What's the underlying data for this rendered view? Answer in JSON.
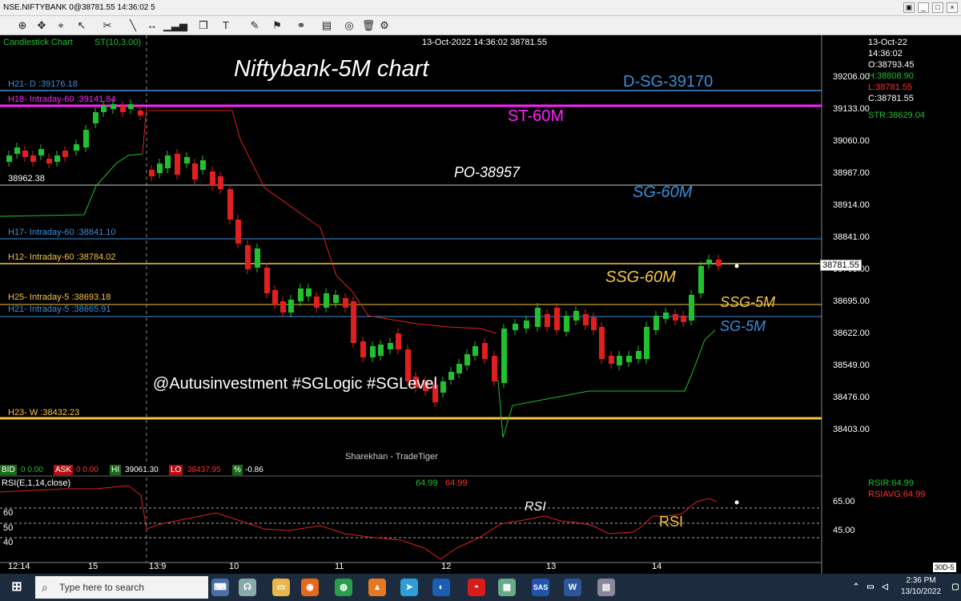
{
  "window": {
    "title": "NSE.NIFTYBANK 0@38781.55 14:36:02 5"
  },
  "toolbar_icons": [
    "crosshair-icon",
    "move-icon",
    "zoom-icon",
    "pointer-icon",
    "line-icon",
    "hline-icon",
    "bars-icon",
    "cube-icon",
    "text-icon",
    "pen-icon",
    "tag-icon",
    "hand-icon",
    "link-icon",
    "book-icon",
    "compass-icon",
    "delete-icon",
    "gear-icon"
  ],
  "chart": {
    "chart_name": "Candlestick Chart",
    "indicator": "ST(10,3.00)",
    "timestamp": "13-Oct-2022 14:36:02 38781.55",
    "big_title": "Niftybank-5M chart",
    "watermark": "@Autusinvestment  #SGLogic  #SGLevel",
    "brand": "Sharekhan - TradeTiger",
    "level_low_label": "38962.38",
    "price_tag": "38781.55"
  },
  "levels": [
    {
      "label": "H21- D :39176.18",
      "color": "#3a8fd8"
    },
    {
      "label": "H18- Intraday-60 :39141.84",
      "color": "#ff22ff"
    },
    {
      "label": "H17- Intraday-60 :38841.10",
      "color": "#3a8fd8"
    },
    {
      "label": "H12- Intraday-60 :38784.02",
      "color": "#f5c542"
    },
    {
      "label": "H25- Intraday-5 :38693.18",
      "color": "#f5c542"
    },
    {
      "label": "H21- Intraday-5 :38665.91",
      "color": "#3a8fd8"
    },
    {
      "label": "H23- W :38432.23",
      "color": "#f5c542"
    }
  ],
  "annotations": [
    {
      "text": "D-SG-39170",
      "color": "#3a8fd8"
    },
    {
      "text": "ST-60M",
      "color": "#ff22ff"
    },
    {
      "text": "PO-38957",
      "color": "#ffffff"
    },
    {
      "text": "SG-60M",
      "color": "#3a8fd8"
    },
    {
      "text": "SSG-60M",
      "color": "#f5c542"
    },
    {
      "text": "SSG-5M",
      "color": "#f5c542"
    },
    {
      "text": "SG-5M",
      "color": "#3a8fd8"
    },
    {
      "text": "RSI",
      "color": "#ffffff"
    },
    {
      "text": "RSI",
      "color": "#f5c542"
    }
  ],
  "price_axis": [
    "39206.00",
    "39133.00",
    "39060.00",
    "38987.00",
    "38914.00",
    "38841.00",
    "38768.00",
    "38695.00",
    "38622.00",
    "38549.00",
    "38476.00",
    "38403.00"
  ],
  "info_panel": {
    "date": "13-Oct-22",
    "time": "14:36:02",
    "open": "O:38793.45",
    "high": "H:38808.90",
    "low": "L:38781.55",
    "close": "C:38781.55",
    "str": "STR:38629.04"
  },
  "status": {
    "bid_label": "BID",
    "bid_val": "0 0.00",
    "ask_label": "ASK",
    "ask_val": "0 0.00",
    "hi_label": "HI",
    "hi_val": "39061.30",
    "lo_label": "LO",
    "lo_val": "38437.95",
    "pct_label": "%",
    "pct_val": "-0.86"
  },
  "rsi": {
    "title": "RSI(E,1,14,close)",
    "val1": "64.99",
    "val2": "64.99",
    "rsir": "RSIR:64.99",
    "rsiavg": "RSIAVG:64.99",
    "axis": [
      "65.00",
      "45.00"
    ],
    "left_ticks": [
      "60",
      "50",
      "40"
    ]
  },
  "time_axis": [
    "12:14",
    "15",
    "13:9",
    "10",
    "11",
    "12",
    "13",
    "14"
  ],
  "period_label": "30D-5",
  "taskbar": {
    "search_placeholder": "Type here to search",
    "time": "2:36 PM",
    "date": "13/10/2022"
  },
  "chart_data": {
    "type": "candlestick",
    "series": [
      {
        "name": "ST(10,3.00)"
      },
      {
        "name": "RSI(E,1,14,close)"
      }
    ],
    "ylim": [
      38380,
      39230
    ],
    "y_ticks": [
      39206,
      39133,
      39060,
      38987,
      38914,
      38841,
      38768,
      38695,
      38622,
      38549,
      38476,
      38403
    ],
    "horizontal_levels": [
      39176.18,
      39141.84,
      38957,
      38841.1,
      38784.02,
      38693.18,
      38665.91,
      38432.23
    ],
    "last_price": 38781.55,
    "rsi_levels": [
      60,
      50,
      40
    ],
    "rsi_axis": [
      65,
      45
    ],
    "rsi_last": 64.99
  }
}
